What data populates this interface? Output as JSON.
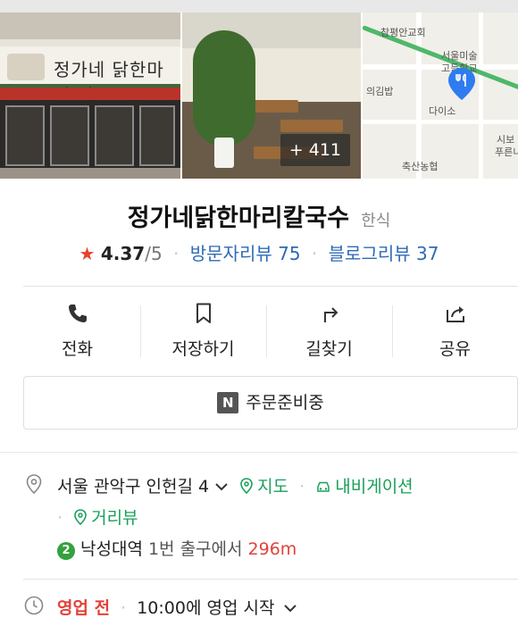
{
  "photos": {
    "storefront_sign": "정가네 닭한마리 칼국수",
    "more_count": "+ 411",
    "map_labels": [
      "참평안교회",
      "서울미술",
      "고등학교",
      "의김밥",
      "다이소",
      "시보",
      "푸른니",
      "축산농협"
    ]
  },
  "place": {
    "name": "정가네닭한마리칼국수",
    "category": "한식",
    "rating_star": "★",
    "rating": "4.37",
    "rating_max": "/5",
    "visitor_reviews": "방문자리뷰 75",
    "blog_reviews": "블로그리뷰 37"
  },
  "actions": [
    {
      "label": "전화",
      "icon": "phone-icon"
    },
    {
      "label": "저장하기",
      "icon": "bookmark-icon"
    },
    {
      "label": "길찾기",
      "icon": "directions-icon"
    },
    {
      "label": "공유",
      "icon": "share-icon"
    }
  ],
  "order": {
    "badge": "N",
    "label": "주문준비중"
  },
  "info": {
    "address": "서울 관악구 인헌길 4",
    "map_link": "지도",
    "navigation_link": "내비게이션",
    "street_view_link": "거리뷰",
    "subway_line": "2",
    "subway_station": "낙성대역",
    "subway_exit": "1번 출구에서",
    "subway_distance": "296m",
    "hours_status": "영업 전",
    "hours_detail": "10:00에 영업 시작"
  },
  "colors": {
    "accent_green": "#19a05a",
    "link_blue": "#2f6bb6",
    "star_red": "#e8402a",
    "closed_red": "#e3413a",
    "route_green": "#4db86a"
  }
}
